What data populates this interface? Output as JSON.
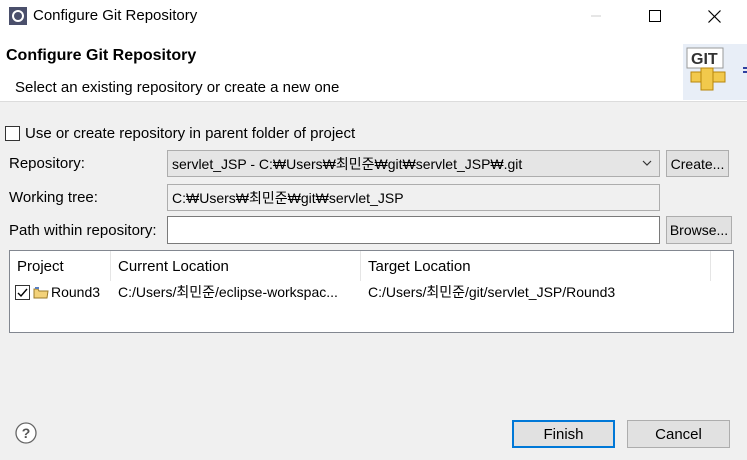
{
  "window": {
    "title": "Configure Git Repository",
    "min_icon": "minimize-icon",
    "max_icon": "maximize-icon",
    "close_icon": "close-icon"
  },
  "banner": {
    "title": "Configure Git Repository",
    "description": "Select an existing repository or create a new one",
    "icon_label": "GIT",
    "icon": "git-icon"
  },
  "form": {
    "parent_folder_checkbox_label": "Use or create repository in parent folder of project",
    "parent_folder_checked": false,
    "repository_label": "Repository:",
    "repository_value": "servlet_JSP - C:₩Users₩최민준₩git₩servlet_JSP₩.git",
    "create_button": "Create...",
    "working_tree_label": "Working tree:",
    "working_tree_value": "C:₩Users₩최민준₩git₩servlet_JSP",
    "path_label": "Path within repository:",
    "path_value": "",
    "browse_button": "Browse..."
  },
  "table": {
    "columns": [
      "Project",
      "Current Location",
      "Target Location"
    ],
    "rows": [
      {
        "checked": true,
        "project": "Round3",
        "current_location": "C:/Users/최민준/eclipse-workspac...",
        "target_location": "C:/Users/최민준/git/servlet_JSP/Round3"
      }
    ]
  },
  "footer": {
    "help_icon": "help-icon",
    "finish_button": "Finish",
    "cancel_button": "Cancel"
  }
}
